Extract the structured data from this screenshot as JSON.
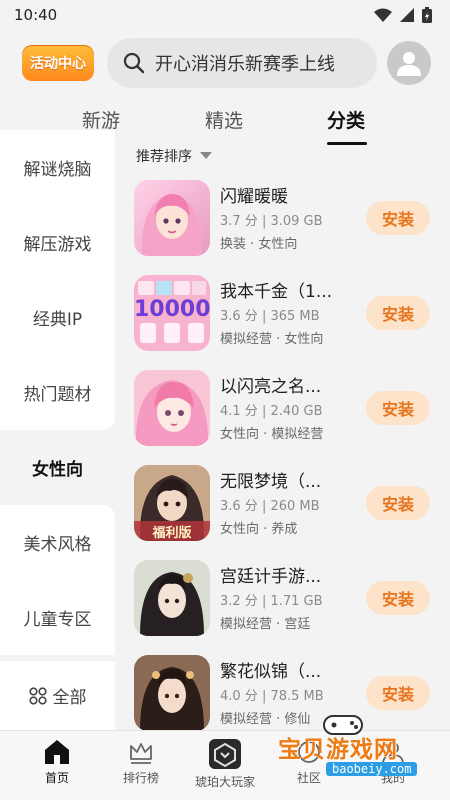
{
  "status": {
    "time": "10:40"
  },
  "header": {
    "activity_label": "活动中心",
    "search_text": "开心消消乐新赛季上线"
  },
  "tabs": [
    {
      "label": "新游"
    },
    {
      "label": "精选"
    },
    {
      "label": "分类"
    }
  ],
  "sidebar": {
    "items": [
      {
        "label": "解谜烧脑"
      },
      {
        "label": "解压游戏"
      },
      {
        "label": "经典IP"
      },
      {
        "label": "热门题材"
      },
      {
        "label": "女性向"
      },
      {
        "label": "美术风格"
      },
      {
        "label": "儿童专区"
      }
    ],
    "all_label": "全部"
  },
  "sort_label": "推荐排序",
  "games": [
    {
      "title": "闪耀暖暖",
      "rating": "3.7 分",
      "size": "3.09 GB",
      "tags": "换装 · 女性向",
      "install": "安装"
    },
    {
      "title": "我本千金（1...",
      "rating": "3.6 分",
      "size": "365 MB",
      "tags": "模拟经营 · 女性向",
      "install": "安装",
      "thumb_text": "10000"
    },
    {
      "title": "以闪亮之名...",
      "rating": "4.1 分",
      "size": "2.40 GB",
      "tags": "女性向 · 模拟经营",
      "install": "安装"
    },
    {
      "title": "无限梦境（...",
      "rating": "3.6 分",
      "size": "260 MB",
      "tags": "女性向 · 养成",
      "install": "安装",
      "thumb_text": "福利版"
    },
    {
      "title": "宫廷计手游...",
      "rating": "3.2 分",
      "size": "1.71 GB",
      "tags": "模拟经营 · 宫廷",
      "install": "安装"
    },
    {
      "title": "繁花似锦（...",
      "rating": "4.0 分",
      "size": "78.5 MB",
      "tags": "模拟经营 · 修仙",
      "install": "安装"
    }
  ],
  "bottom_nav": [
    {
      "label": "首页",
      "icon": "home-icon"
    },
    {
      "label": "排行榜",
      "icon": "crown-icon"
    },
    {
      "label": "琥珀大玩家",
      "icon": "amber-logo-icon"
    },
    {
      "label": "社区",
      "icon": "community-icon"
    },
    {
      "label": "我的",
      "icon": "profile-icon"
    }
  ],
  "watermark": {
    "text": "宝贝游戏网",
    "url": "baobeiy.com"
  },
  "colors": {
    "accent": "#e8751e",
    "install_bg": "#fde3c9",
    "badge": "#ff9a24"
  }
}
